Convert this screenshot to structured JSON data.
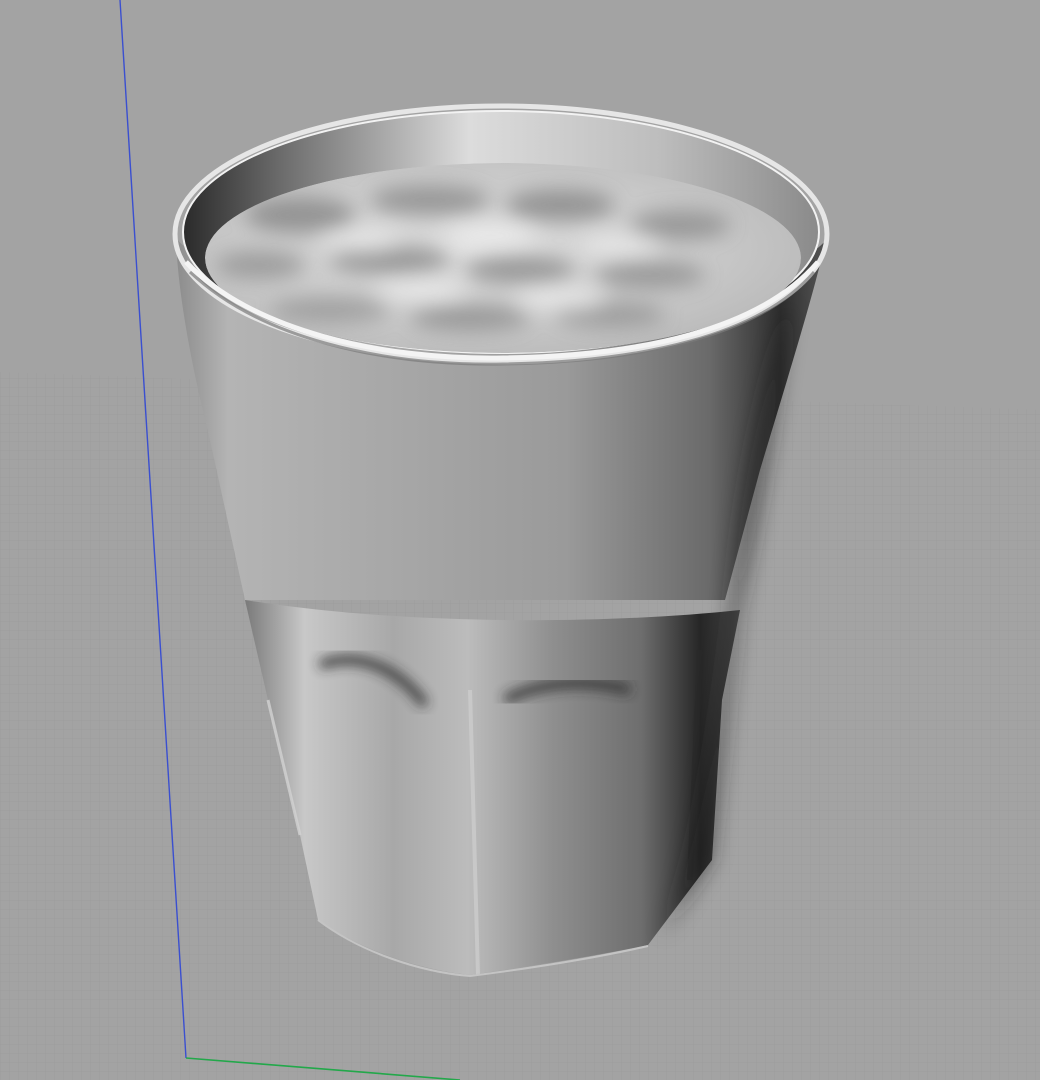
{
  "viewport": {
    "view": "perspective",
    "shading": "shaded",
    "grid_visible": true,
    "background_color": "#a3a3a3",
    "grid_line_color": "#9a9a9a",
    "axes": {
      "x_color": "#22a84a",
      "z_color": "#3a4fd0"
    }
  },
  "model": {
    "object": "tumbler-glass",
    "contents": "liquid-surface",
    "material_color": "#9e9e9e"
  }
}
